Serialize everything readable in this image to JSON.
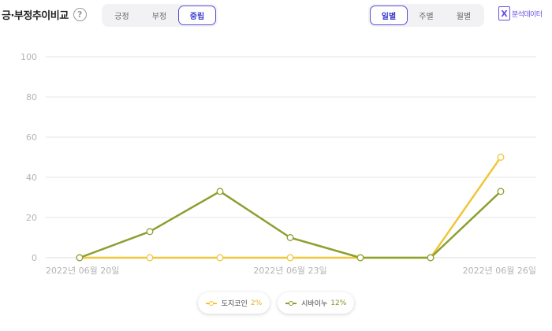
{
  "header": {
    "title": "긍·부정추이비교",
    "help_symbol": "?",
    "sentiment_tabs": [
      "긍정",
      "부정",
      "중립"
    ],
    "sentiment_active": "중립",
    "period_tabs": [
      "일별",
      "주별",
      "월별"
    ],
    "period_active": "일별",
    "export_symbol": "X",
    "export_label": "분석데이터"
  },
  "colors": {
    "accent": "#5b4fd6",
    "series_dogecoin": "#f0c63a",
    "series_shiba": "#8aa030",
    "grid": "#e6e6e6",
    "axis_text": "#b3b3b3"
  },
  "legend": [
    {
      "name": "도지코인",
      "pct": "2%"
    },
    {
      "name": "시바이누",
      "pct": "12%"
    }
  ],
  "chart_data": {
    "type": "line",
    "x": [
      "2022-06-20",
      "2022-06-21",
      "2022-06-22",
      "2022-06-23",
      "2022-06-24",
      "2022-06-25",
      "2022-06-26"
    ],
    "x_tick_labels": [
      "2022년 06월 20일",
      "2022년 06월 23일",
      "2022년 06월 26일"
    ],
    "x_tick_indices": [
      0,
      3,
      6
    ],
    "ylim": [
      0,
      100
    ],
    "y_ticks": [
      0,
      20,
      40,
      60,
      80,
      100
    ],
    "grid": true,
    "legend_position": "bottom-center",
    "series": [
      {
        "name": "도지코인",
        "values": [
          0,
          0,
          0,
          0,
          0,
          0,
          50
        ]
      },
      {
        "name": "시바이누",
        "values": [
          0,
          13,
          33,
          10,
          0,
          0,
          33
        ]
      }
    ]
  }
}
